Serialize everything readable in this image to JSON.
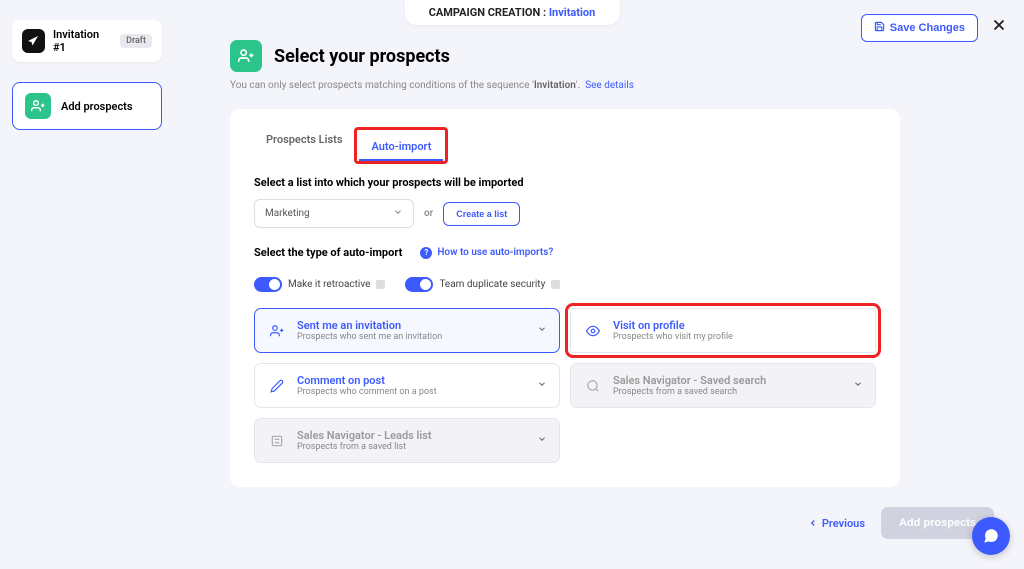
{
  "top_banner": {
    "label": "CAMPAIGN CREATION :",
    "step": "Invitation"
  },
  "save_button": "Save Changes",
  "sidebar": {
    "campaign_name": "Invitation #1",
    "draft_label": "Draft",
    "step_label": "Add prospects"
  },
  "page": {
    "title": "Select your prospects",
    "hint_prefix": "You can only select prospects matching conditions of the sequence '",
    "hint_seq": "Invitation",
    "hint_suffix": "'.",
    "see_details": "See details"
  },
  "tabs": {
    "prospects_lists": "Prospects Lists",
    "auto_import": "Auto-import"
  },
  "list_section": {
    "label": "Select a list into which your prospects will be imported",
    "selected": "Marketing",
    "or": "or",
    "create": "Create a list"
  },
  "auto_section": {
    "label": "Select the type of auto-import",
    "help_link": "How to use auto-imports?",
    "toggle1": "Make it retroactive",
    "toggle2": "Team duplicate security"
  },
  "options": {
    "sent_invitation": {
      "title": "Sent me an invitation",
      "sub": "Prospects who sent me an invitation"
    },
    "visit_profile": {
      "title": "Visit on profile",
      "sub": "Prospects who visit my profile"
    },
    "comment_post": {
      "title": "Comment on post",
      "sub": "Prospects who comment on a post"
    },
    "saved_search": {
      "title": "Sales Navigator - Saved search",
      "sub": "Prospects from a saved search"
    },
    "leads_list": {
      "title": "Sales Navigator - Leads list",
      "sub": "Prospects from a saved list"
    }
  },
  "footer": {
    "previous": "Previous",
    "add": "Add prospects"
  }
}
